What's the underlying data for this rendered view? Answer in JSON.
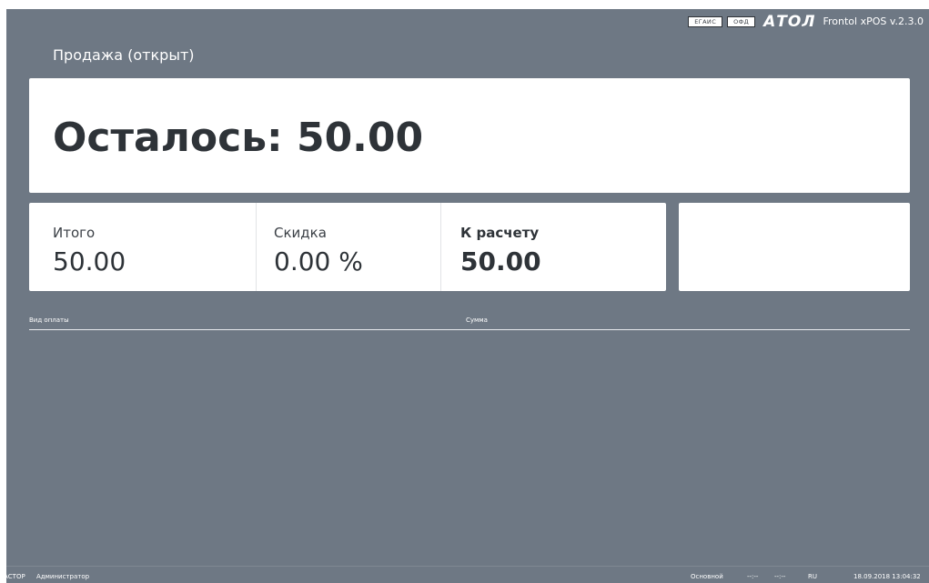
{
  "header": {
    "chips": [
      "ЕГАИС",
      "ОФД"
    ],
    "logo": "АТОЛ",
    "version": "Frontol xPOS v.2.3.0"
  },
  "document_status": "Продажа (открыт)",
  "remaining": "Осталось: 50.00",
  "totals": {
    "total_label": "Итого",
    "total_value": "50.00",
    "discount_label": "Скидка",
    "discount_value": "0.00 %",
    "payable_label": "К расчету",
    "payable_value": "50.00"
  },
  "payments": {
    "columns": [
      "Вид оплаты",
      "Сумма"
    ],
    "rows": []
  },
  "footer": {
    "station": "АСТОР",
    "user": "Администратор",
    "mode": "Основной",
    "field1": "--:--",
    "field2": "--:--",
    "language": "RU",
    "datetime": "18.09.2018 13:04:32"
  },
  "colors": {
    "background": "#6e7884",
    "card": "#ffffff",
    "text_dark": "#2e3338"
  }
}
